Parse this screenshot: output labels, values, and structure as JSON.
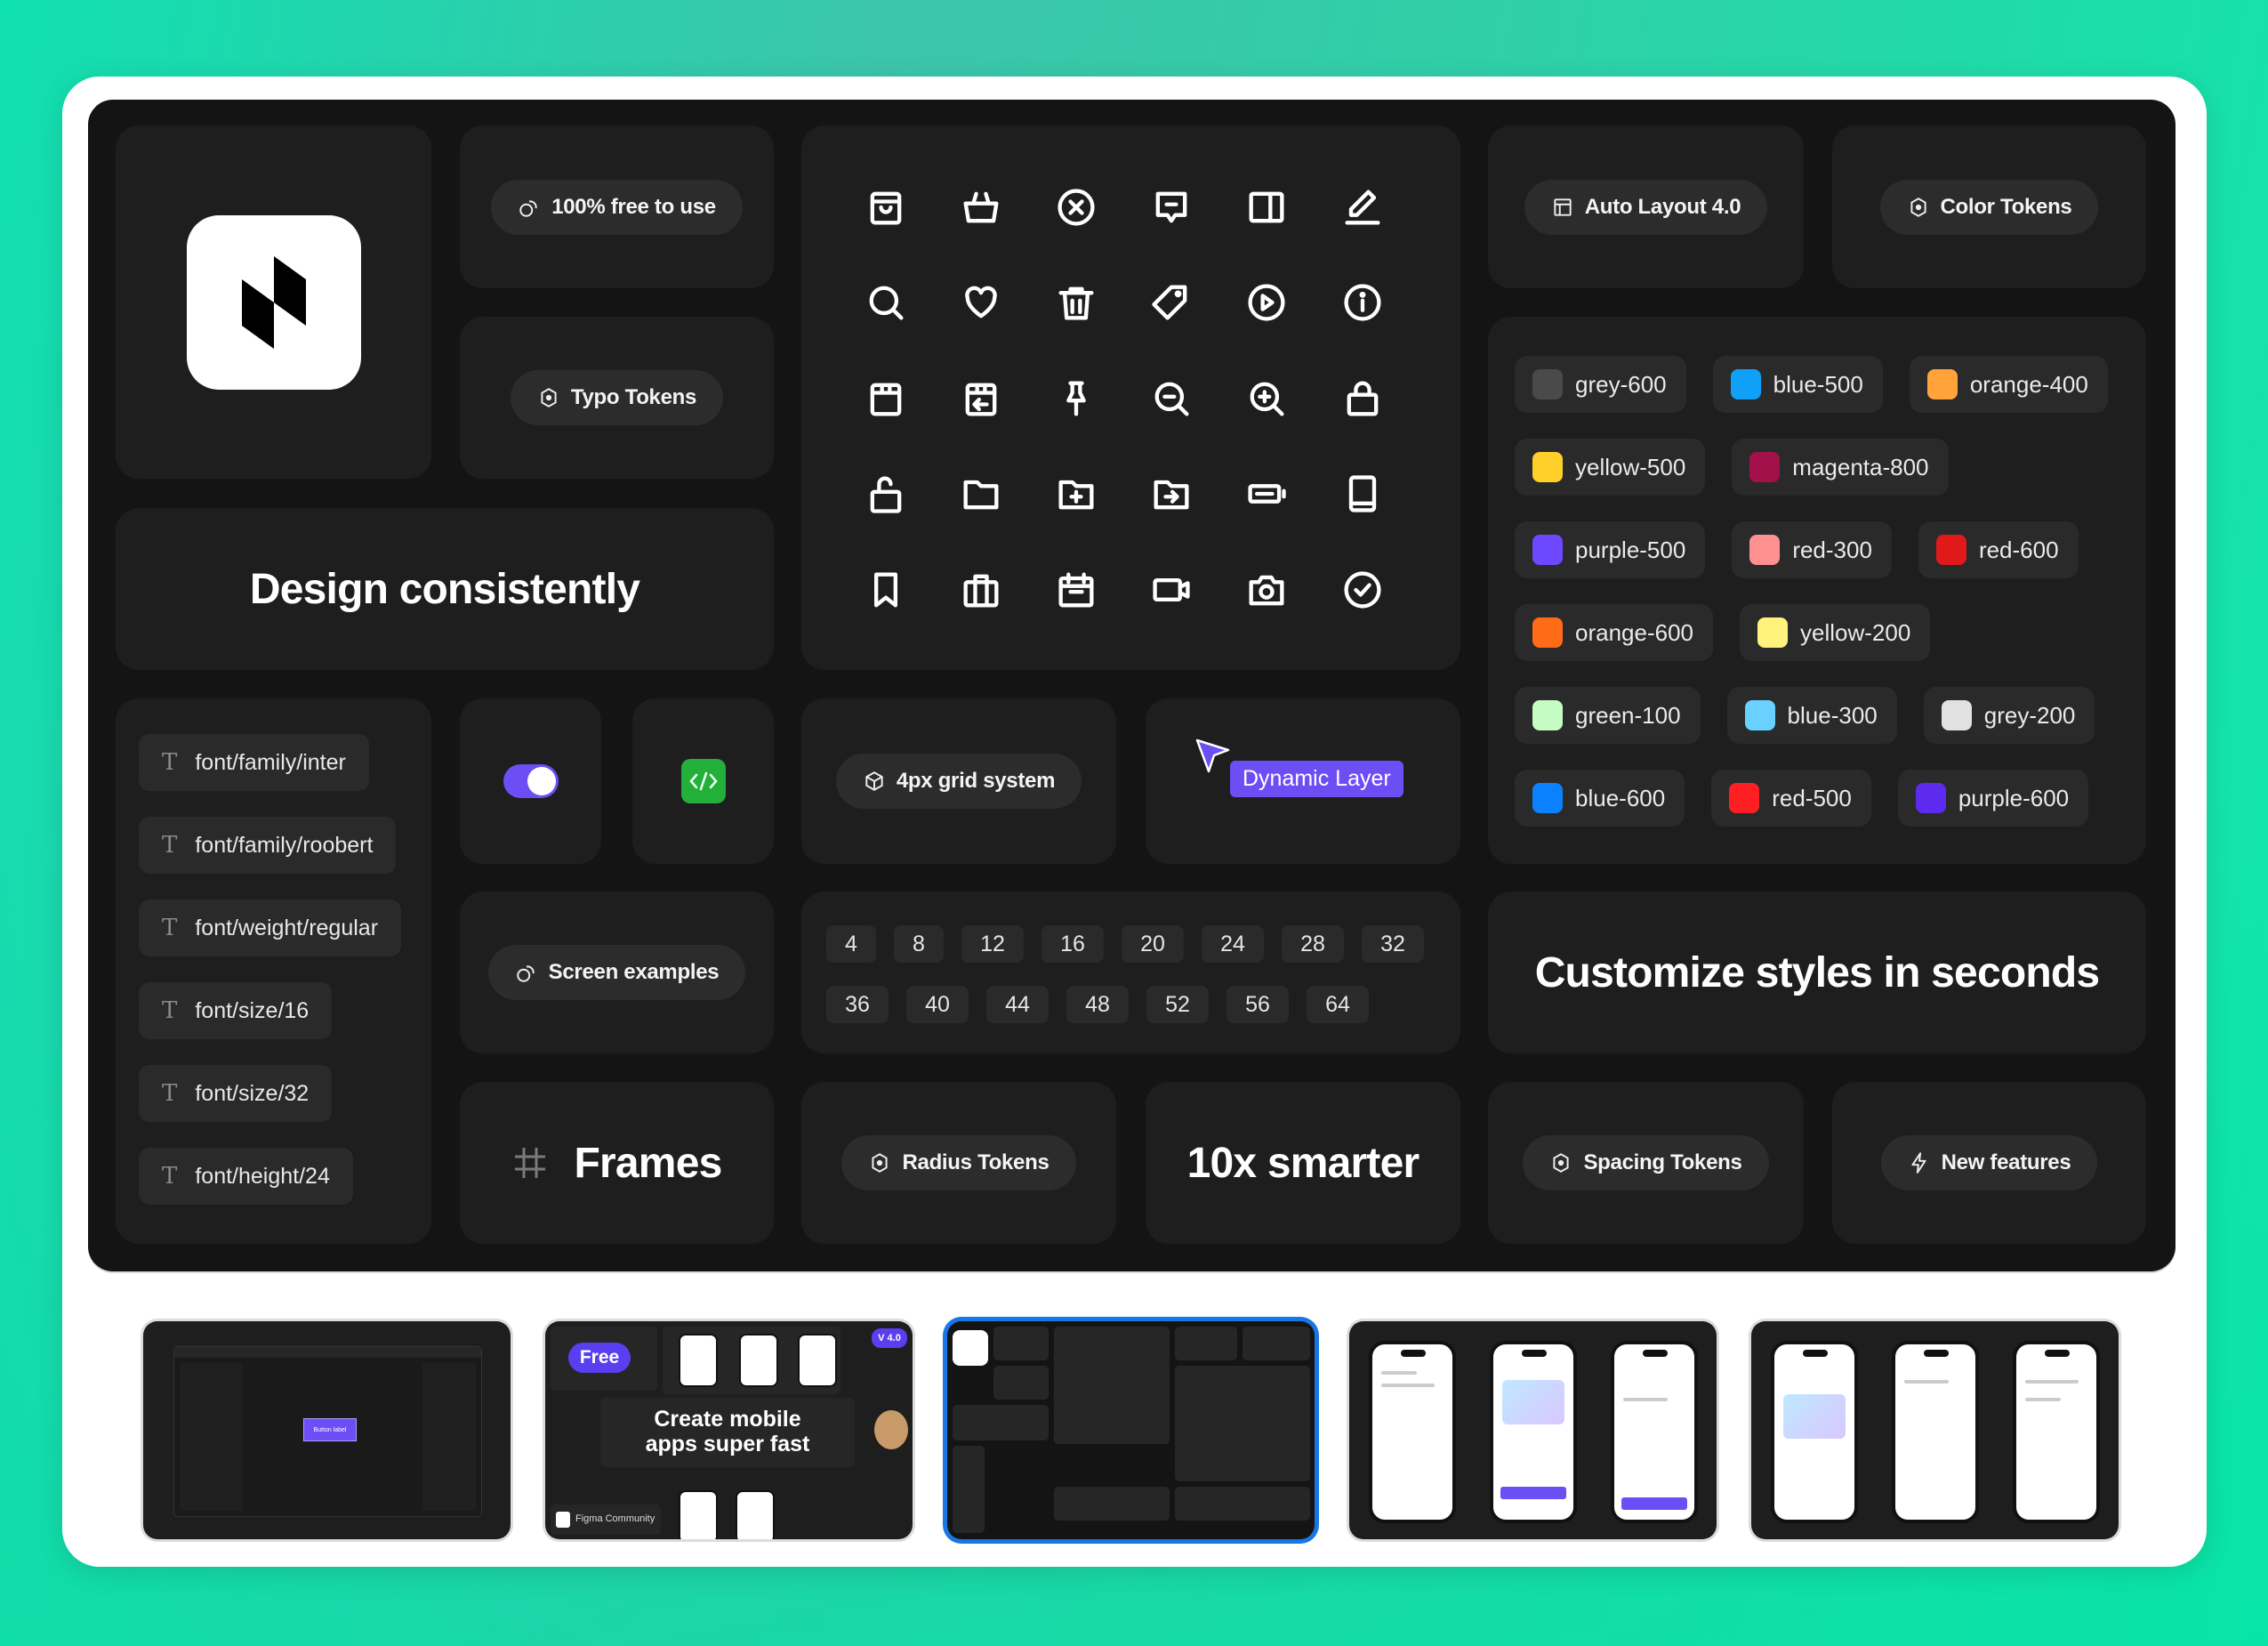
{
  "showcase": {
    "badges": {
      "free": "100% free to use",
      "typo_tokens": "Typo Tokens",
      "auto_layout": "Auto Layout 4.0",
      "color_tokens": "Color Tokens",
      "grid_system": "4px grid system",
      "screen_examples": "Screen examples",
      "radius_tokens": "Radius Tokens",
      "spacing_tokens": "Spacing Tokens",
      "new_features": "New features"
    },
    "headlines": {
      "design": "Design consistently",
      "customize": "Customize styles in seconds",
      "frames": "Frames",
      "smarter": "10x smarter"
    },
    "dynamic_layer_label": "Dynamic Layer",
    "toggle": {
      "state": "on",
      "color": "#6c4ef5"
    },
    "code_badge_color": "#22b03a",
    "icons": [
      [
        "shopping-bag-icon",
        "basket-icon",
        "close-circle-icon",
        "message-minus-icon",
        "sidebar-layout-icon",
        "edit-pencil-icon"
      ],
      [
        "search-icon",
        "heart-icon",
        "trash-icon",
        "tag-icon",
        "play-circle-icon",
        "info-circle-icon"
      ],
      [
        "box-icon",
        "box-return-icon",
        "pin-icon",
        "zoom-out-icon",
        "zoom-in-icon",
        "lock-icon"
      ],
      [
        "unlock-icon",
        "folder-icon",
        "folder-add-icon",
        "folder-move-icon",
        "battery-icon",
        "tablet-icon"
      ],
      [
        "bookmark-icon",
        "briefcase-icon",
        "calendar-icon",
        "video-camera-icon",
        "camera-icon",
        "check-circle-icon"
      ]
    ],
    "typography_tokens": [
      "font/family/inter",
      "font/family/roobert",
      "font/weight/regular",
      "font/size/16",
      "font/size/32",
      "font/height/24"
    ],
    "color_tokens": [
      [
        {
          "name": "grey-600",
          "hex": "#4a4a4a"
        },
        {
          "name": "blue-500",
          "hex": "#11a0f8"
        },
        {
          "name": "orange-400",
          "hex": "#ffa33a"
        }
      ],
      [
        {
          "name": "yellow-500",
          "hex": "#ffd02a"
        },
        {
          "name": "magenta-800",
          "hex": "#a3104a"
        }
      ],
      [
        {
          "name": "purple-500",
          "hex": "#6d48ff"
        },
        {
          "name": "red-300",
          "hex": "#ff9090"
        },
        {
          "name": "red-600",
          "hex": "#e0191b"
        }
      ],
      [
        {
          "name": "orange-600",
          "hex": "#ff6b17"
        },
        {
          "name": "yellow-200",
          "hex": "#fff37d"
        }
      ],
      [
        {
          "name": "green-100",
          "hex": "#c6fcc3"
        },
        {
          "name": "blue-300",
          "hex": "#69d1ff"
        },
        {
          "name": "grey-200",
          "hex": "#e1e1e1"
        }
      ],
      [
        {
          "name": "blue-600",
          "hex": "#0a82ff"
        },
        {
          "name": "red-500",
          "hex": "#ff1f22"
        },
        {
          "name": "purple-600",
          "hex": "#5d2bf0"
        }
      ]
    ],
    "spacing_values": [
      [
        "4",
        "8",
        "12",
        "16",
        "20",
        "24",
        "28",
        "32"
      ],
      [
        "36",
        "40",
        "44",
        "48",
        "52",
        "56",
        "64"
      ]
    ]
  },
  "thumbnails": [
    {
      "label": "Editor preview",
      "inner_button": "Button label",
      "active": false
    },
    {
      "label": "Cover",
      "free_badge": "Free",
      "version_badge": "V 4.0",
      "title_line1": "Create mobile",
      "title_line2": "apps super fast",
      "community_label": "Figma Community",
      "active": false
    },
    {
      "label": "Design system overview",
      "active": true
    },
    {
      "label": "Mobile screens set 1",
      "active": false
    },
    {
      "label": "Mobile screens set 2",
      "active": false
    }
  ]
}
